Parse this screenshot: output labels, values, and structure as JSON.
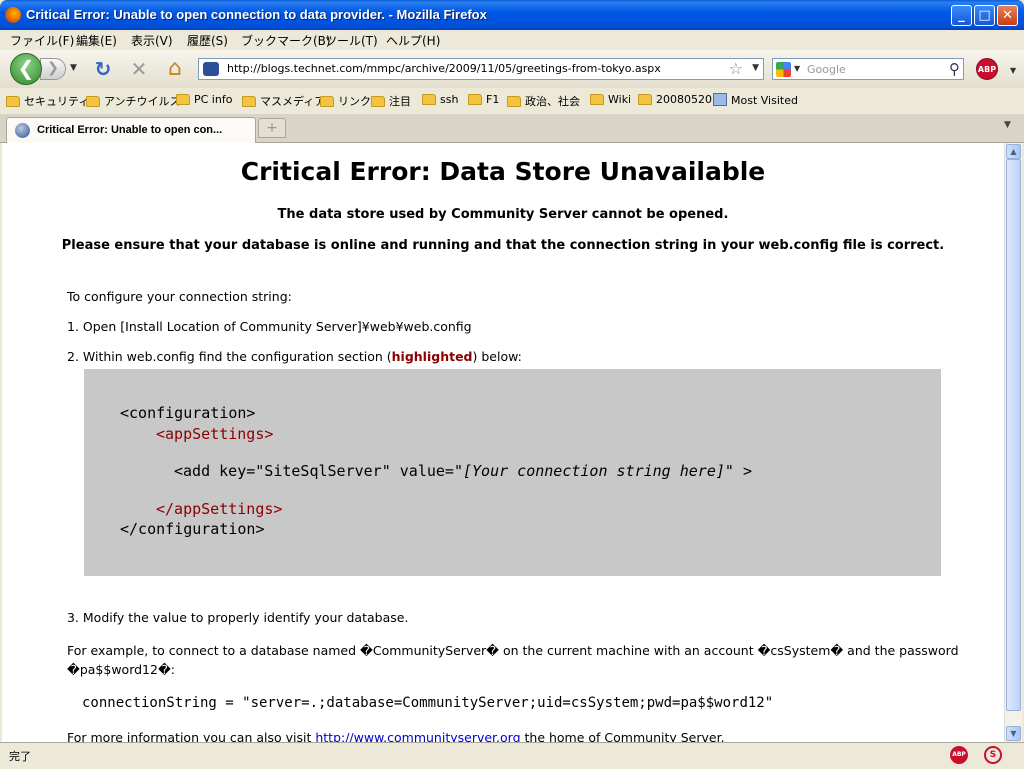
{
  "window": {
    "title": "Critical Error: Unable to open connection to data provider. - Mozilla Firefox",
    "min_label": "_",
    "max_label": "□",
    "close_label": "✕"
  },
  "menu": [
    "ファイル(F)",
    "編集(E)",
    "表示(V)",
    "履歴(S)",
    "ブックマーク(B)",
    "ツール(T)",
    "ヘルプ(H)"
  ],
  "nav": {
    "back": "❮",
    "forward": "❯",
    "history_dropdown": "▼",
    "reload_icon": "↻",
    "stop_icon": "✕",
    "home_icon": "⌂",
    "url": "http://blogs.technet.com/mmpc/archive/2009/11/05/greetings-from-tokyo.aspx",
    "url_star": "☆",
    "url_dropdown": "▼",
    "search_placeholder": "Google",
    "search_dropdown": "▼",
    "search_icon": "⚲",
    "abp_label": "ABP",
    "abp_dropdown": "▼"
  },
  "bookmarks": [
    "セキュリティ",
    "アンチウイルス",
    "PC info",
    "マスメディア",
    "リンク",
    "注目",
    "ssh",
    "F1",
    "政治、社会",
    "Wiki",
    "20080520",
    "Most Visited"
  ],
  "tabs": {
    "active_title": "Critical Error: Unable to open con...",
    "new_tab": "+",
    "scroll": "▼"
  },
  "page": {
    "heading": "Critical Error: Data Store Unavailable",
    "sub1": "The data store used by Community Server cannot be opened.",
    "sub2": "Please ensure that your database is online and running and that the connection string in your web.config file is correct.",
    "configure_intro": "To configure your connection string:",
    "step1": "1. Open [Install Location of Community Server]¥web¥web.config",
    "step2_pre": "2. Within web.config find the configuration section (",
    "step2_hl": "highlighted",
    "step2_post": ") below:",
    "code": {
      "line1": "<configuration>",
      "line2": "<appSettings>",
      "line3_pre": "<add key=\"SiteSqlServer\" value=\"",
      "line3_val": "[Your connection string here]",
      "line3_post": "\" >",
      "line4": "</appSettings>",
      "line5": "</configuration>"
    },
    "step3": "3. Modify the value to properly identify your database.",
    "example_line1": "For example, to connect to a database named �CommunityServer� on the current machine with an account �csSystem� and the password",
    "example_line2": "�pa$$word12�:",
    "conn_string": "connectionString = \"server=.;database=CommunityServer;uid=csSystem;pwd=pa$$word12\"",
    "more_pre": "For more information you can also visit ",
    "more_link": "http://www.communityserver.org",
    "more_post": " the home of Community Server."
  },
  "scrollbar": {
    "up": "▲",
    "down": "▼"
  },
  "status": {
    "text": "完了",
    "abp": "ABP",
    "noscript": "S"
  }
}
